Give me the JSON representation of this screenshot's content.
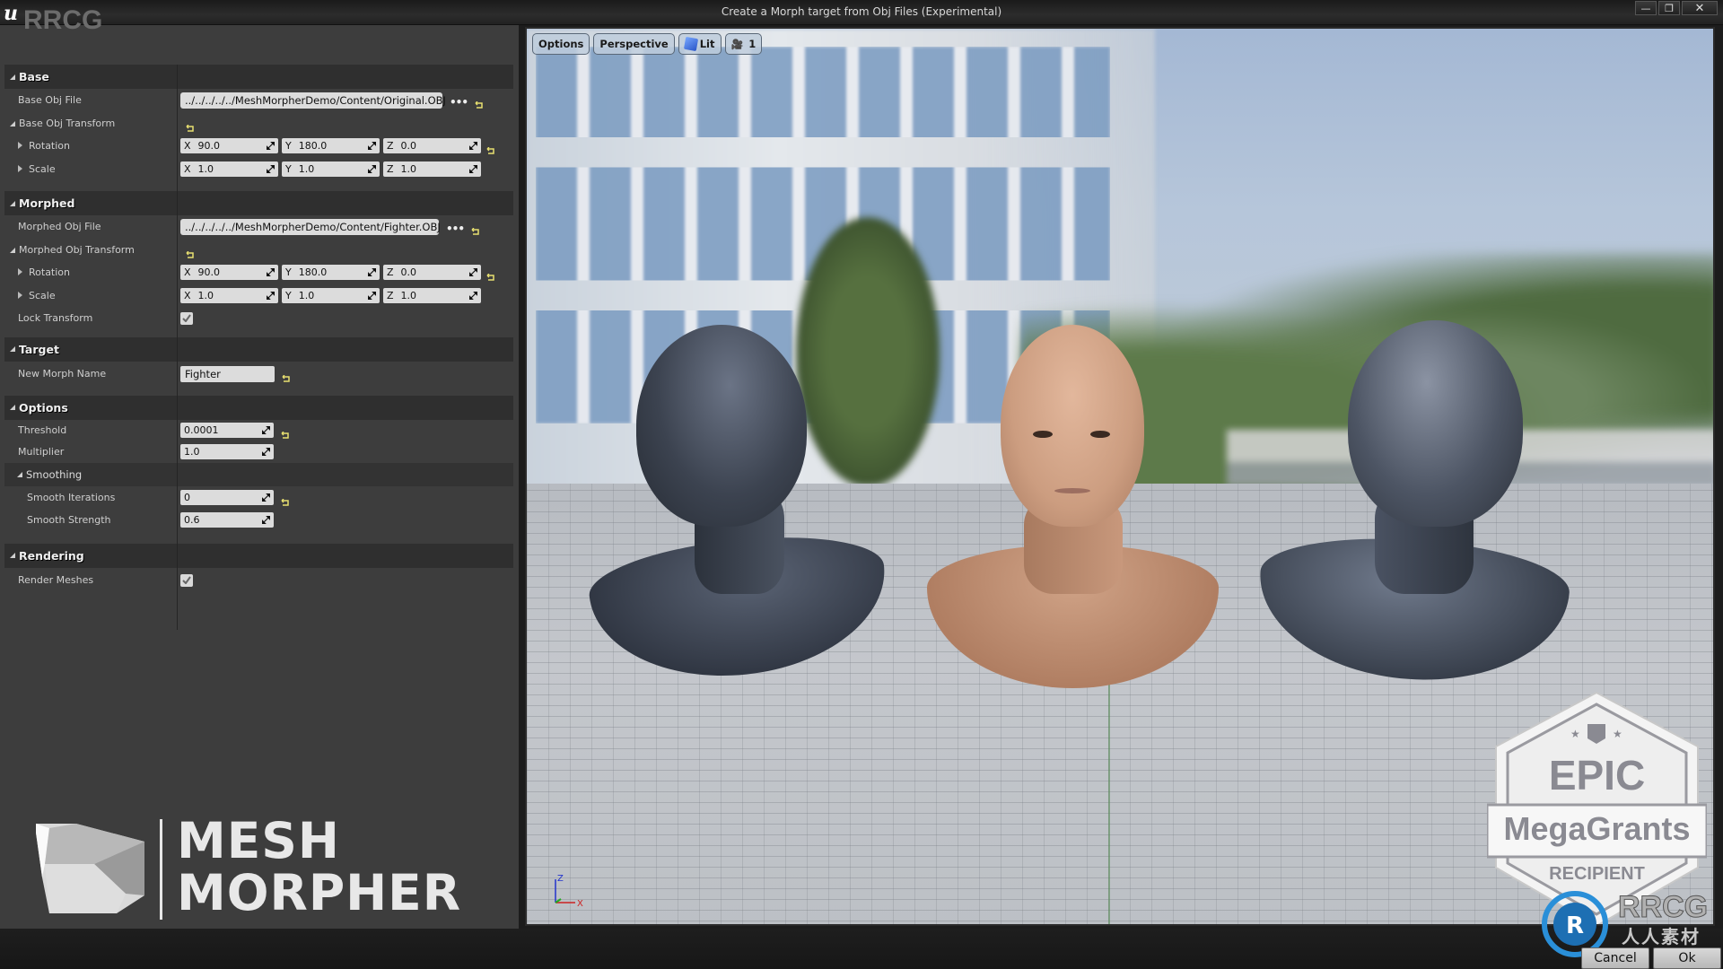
{
  "window": {
    "title": "Create a Morph target from Obj Files (Experimental)",
    "watermark": "RRCG",
    "controls": {
      "minimize": "—",
      "restore": "❐",
      "close": "✕"
    }
  },
  "sections": {
    "base": {
      "title": "Base",
      "obj_file_label": "Base Obj File",
      "obj_file_value": "../../../../../MeshMorpherDemo/Content/Original.OBJ",
      "transform_label": "Base Obj Transform",
      "rotation_label": "Rotation",
      "rotation": {
        "x": "90.0",
        "y": "180.0",
        "z": "0.0"
      },
      "scale_label": "Scale",
      "scale": {
        "x": "1.0",
        "y": "1.0",
        "z": "1.0"
      }
    },
    "morphed": {
      "title": "Morphed",
      "obj_file_label": "Morphed Obj File",
      "obj_file_value": "../../../../../MeshMorpherDemo/Content/Fighter.OBJ",
      "transform_label": "Morphed Obj Transform",
      "rotation_label": "Rotation",
      "rotation": {
        "x": "90.0",
        "y": "180.0",
        "z": "0.0"
      },
      "scale_label": "Scale",
      "scale": {
        "x": "1.0",
        "y": "1.0",
        "z": "1.0"
      },
      "lock_transform_label": "Lock Transform",
      "lock_transform": true
    },
    "target": {
      "title": "Target",
      "new_morph_name_label": "New Morph Name",
      "new_morph_name": "Fighter"
    },
    "options": {
      "title": "Options",
      "threshold_label": "Threshold",
      "threshold": "0.0001",
      "multiplier_label": "Multiplier",
      "multiplier": "1.0",
      "smoothing_title": "Smoothing",
      "smooth_iterations_label": "Smooth Iterations",
      "smooth_iterations": "0",
      "smooth_strength_label": "Smooth Strength",
      "smooth_strength": "0.6"
    },
    "rendering": {
      "title": "Rendering",
      "render_meshes_label": "Render Meshes",
      "render_meshes": true
    }
  },
  "axis_labels": {
    "x": "X",
    "y": "Y",
    "z": "Z"
  },
  "logo": {
    "line1": "MESH",
    "line2": "MORPHER"
  },
  "viewport": {
    "toolbar": {
      "options": "Options",
      "perspective": "Perspective",
      "lit": "Lit",
      "speed": "1"
    },
    "gizmo": {
      "x": "X",
      "z": "Z"
    },
    "badge": {
      "top": "EPIC",
      "middle": "MegaGrants",
      "bottom": "RECIPIENT"
    }
  },
  "watermark_bottom": {
    "text": "RRCG",
    "sub": "人人素材"
  },
  "buttons": {
    "cancel": "Cancel",
    "ok": "Ok"
  },
  "colors": {
    "panel_bg": "#3d3d3d",
    "section_bg": "#2f2f2f",
    "field_bg": "#dcdcdc",
    "reset_arrow": "#e8e070",
    "accent_blue": "#2a8fd8"
  }
}
